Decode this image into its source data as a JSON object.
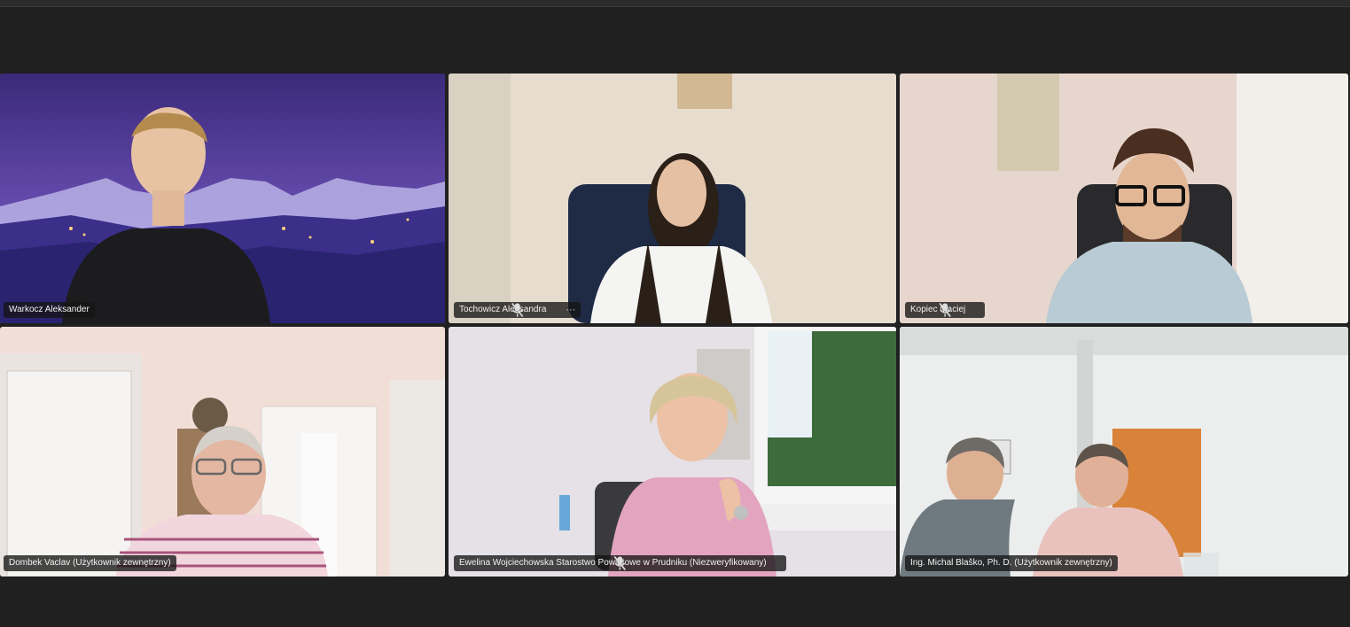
{
  "participants": [
    {
      "name": "Warkocz Aleksander",
      "muted": false
    },
    {
      "name": "Tochowicz Aleksandra",
      "muted": true,
      "more": "···"
    },
    {
      "name": "Kopiec Maciej",
      "muted": true
    },
    {
      "name": "Dombek Vaclav (Użytkownik zewnętrzny)",
      "muted": false
    },
    {
      "name": "Ewelina Wojciechowska Starostwo Powiatowe w Prudniku (Niezweryfikowany)",
      "muted": true
    },
    {
      "name": "Ing. Michal Blaško, Ph. D. (Użytkownik zewnętrzny)",
      "muted": false
    }
  ],
  "colors": {
    "background": "#202020",
    "tile_label_bg": "#141414",
    "label_text": "#f2f2f2"
  },
  "icons": [
    "mic-muted-icon",
    "more-options-icon"
  ]
}
